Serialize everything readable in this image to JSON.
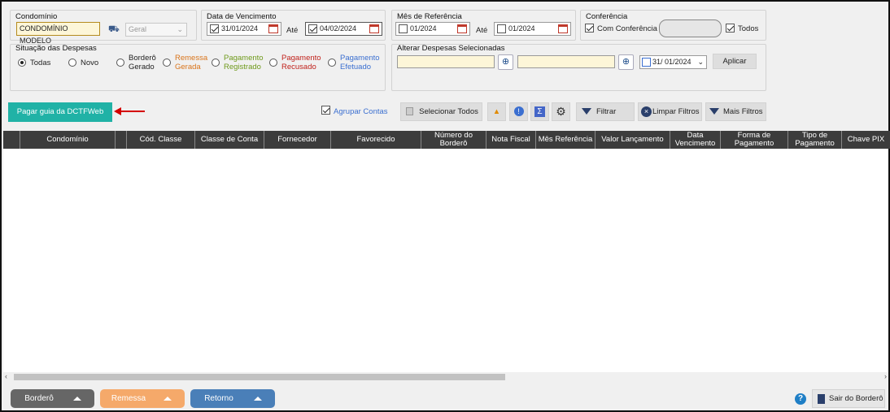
{
  "condominio": {
    "title": "Condomínio",
    "value": "CONDOMÍNIO MODELO",
    "tipo": "Geral"
  },
  "vencimento": {
    "title": "Data de Vencimento",
    "from": "31/01/2024",
    "ate": "Até",
    "to": "04/02/2024"
  },
  "mes_ref": {
    "title": "Mês de Referência",
    "from": "01/2024",
    "ate": "Até",
    "to": "01/2024"
  },
  "conferencia": {
    "title": "Conferência",
    "com": "Com Conferência",
    "todos": "Todos"
  },
  "situacao": {
    "title": "Situação das Despesas",
    "options": [
      {
        "label": "Todas",
        "color": "#111111"
      },
      {
        "label": "Novo",
        "color": "#111111"
      },
      {
        "label": "Borderô Gerado",
        "color": "#111111"
      },
      {
        "label": "Remessa Gerada",
        "color": "#d9741b"
      },
      {
        "label": "Pagamento Registrado",
        "color": "#6f9a1c"
      },
      {
        "label": "Pagamento Recusado",
        "color": "#c0221c"
      },
      {
        "label": "Pagamento Efetuado",
        "color": "#3b6fd0"
      }
    ]
  },
  "alterar": {
    "title": "Alterar Despesas Selecionadas",
    "date": "31/ 01/2024",
    "aplicar": "Aplicar"
  },
  "toolbar": {
    "pagar": "Pagar guia da DCTFWeb",
    "agrupar": "Agrupar Contas",
    "selecionar": "Selecionar Todos",
    "filtrar": "Filtrar",
    "limpar": "Limpar Filtros",
    "mais": "Mais Filtros"
  },
  "columns": [
    "Condomínio",
    "Cód. Classe",
    "Classe de Conta",
    "Fornecedor",
    "Favorecido",
    "Número do Borderô",
    "Nota Fiscal",
    "Mês Referência",
    "Valor Lançamento",
    "Data Vencimento",
    "Forma de Pagamento",
    "Tipo de Pagamento",
    "Chave PIX"
  ],
  "footer": {
    "bordero": "Borderô",
    "remessa": "Remessa",
    "retorno": "Retorno",
    "sair": "Sair do Borderô"
  },
  "colors": {
    "accent": "#20b2a6",
    "bordero": "#666666",
    "remessa": "#f5a96a",
    "retorno": "#4a7fb8"
  }
}
